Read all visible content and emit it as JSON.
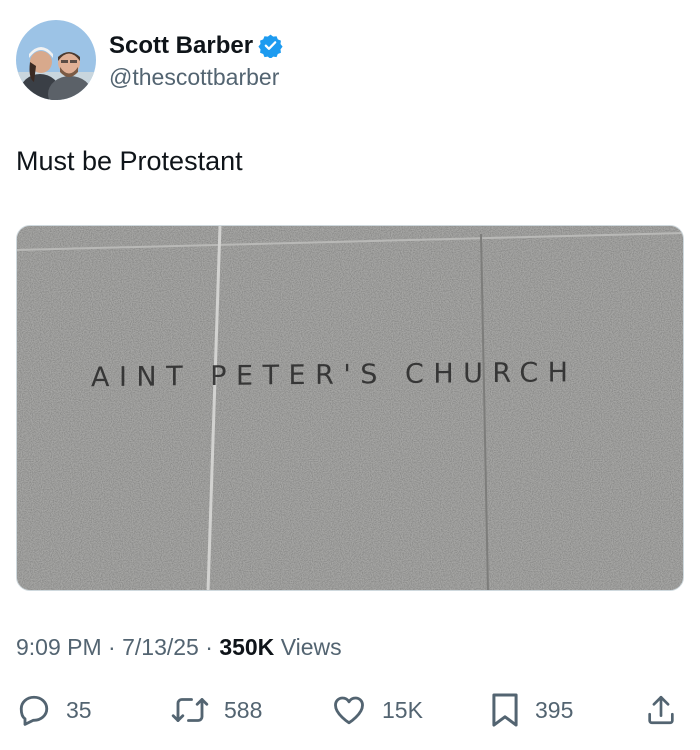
{
  "user": {
    "display_name": "Scott Barber",
    "handle": "@thescottbarber",
    "verified": true,
    "verified_color": "#1d9bf0"
  },
  "tweet": {
    "text": "Must be Protestant"
  },
  "photo": {
    "sign_text": "AINT PETER'S CHURCH"
  },
  "meta": {
    "time": "9:09 PM",
    "separator": "·",
    "date": "7/13/25",
    "views_count": "350K",
    "views_label": "Views"
  },
  "actions": {
    "replies": "35",
    "reposts": "588",
    "likes": "15K",
    "bookmarks": "395"
  },
  "icons": {
    "reply": "reply-icon",
    "repost": "repost-icon",
    "like": "heart-icon",
    "bookmark": "bookmark-icon",
    "share": "share-icon"
  },
  "colors": {
    "text": "#0f1419",
    "secondary": "#536471",
    "accent": "#1d9bf0"
  }
}
